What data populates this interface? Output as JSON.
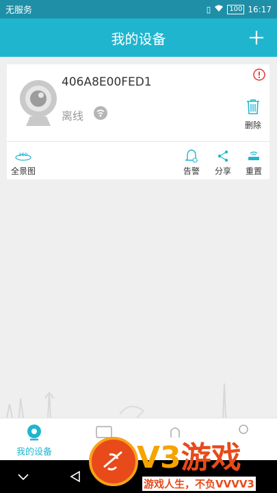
{
  "status_bar": {
    "carrier": "无服务",
    "battery": "100",
    "time": "16:17"
  },
  "header": {
    "title": "我的设备"
  },
  "device": {
    "id": "406A8E00FED1",
    "status": "离线",
    "delete_label": "删除"
  },
  "actions": {
    "panorama": "全景图",
    "alarm": "告警",
    "share": "分享",
    "reset": "重置",
    "panorama_badge": "360"
  },
  "tabs": {
    "my_devices": "我的设备"
  },
  "watermark": {
    "logo": "V3",
    "logo_cn": "游戏",
    "tagline": "游戏人生，不负VVVV3"
  },
  "colors": {
    "accent": "#1fb5cf",
    "status_bar": "#1f8fa7",
    "alert": "#e03131"
  }
}
